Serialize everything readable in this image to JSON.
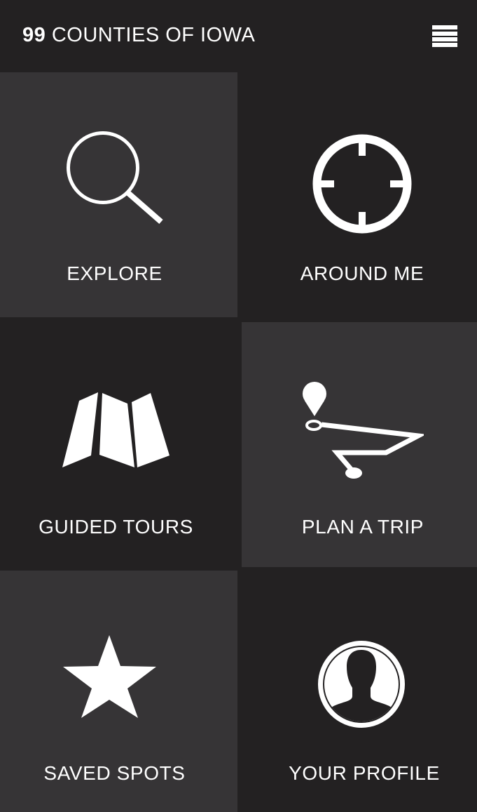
{
  "app": {
    "title_number": "99",
    "title_text": "COUNTIES OF IOWA",
    "menu_icon": "hamburger-menu-icon"
  },
  "tiles": [
    {
      "label": "EXPLORE",
      "icon": "search-icon"
    },
    {
      "label": "AROUND ME",
      "icon": "crosshair-icon"
    },
    {
      "label": "GUIDED TOURS",
      "icon": "folded-map-icon"
    },
    {
      "label": "PLAN A TRIP",
      "icon": "route-pin-icon"
    },
    {
      "label": "SAVED SPOTS",
      "icon": "star-icon"
    },
    {
      "label": "YOUR PROFILE",
      "icon": "user-silhouette-icon"
    }
  ],
  "colors": {
    "background_dark": "#232122",
    "tile_light": "#363436",
    "text": "#ffffff"
  }
}
